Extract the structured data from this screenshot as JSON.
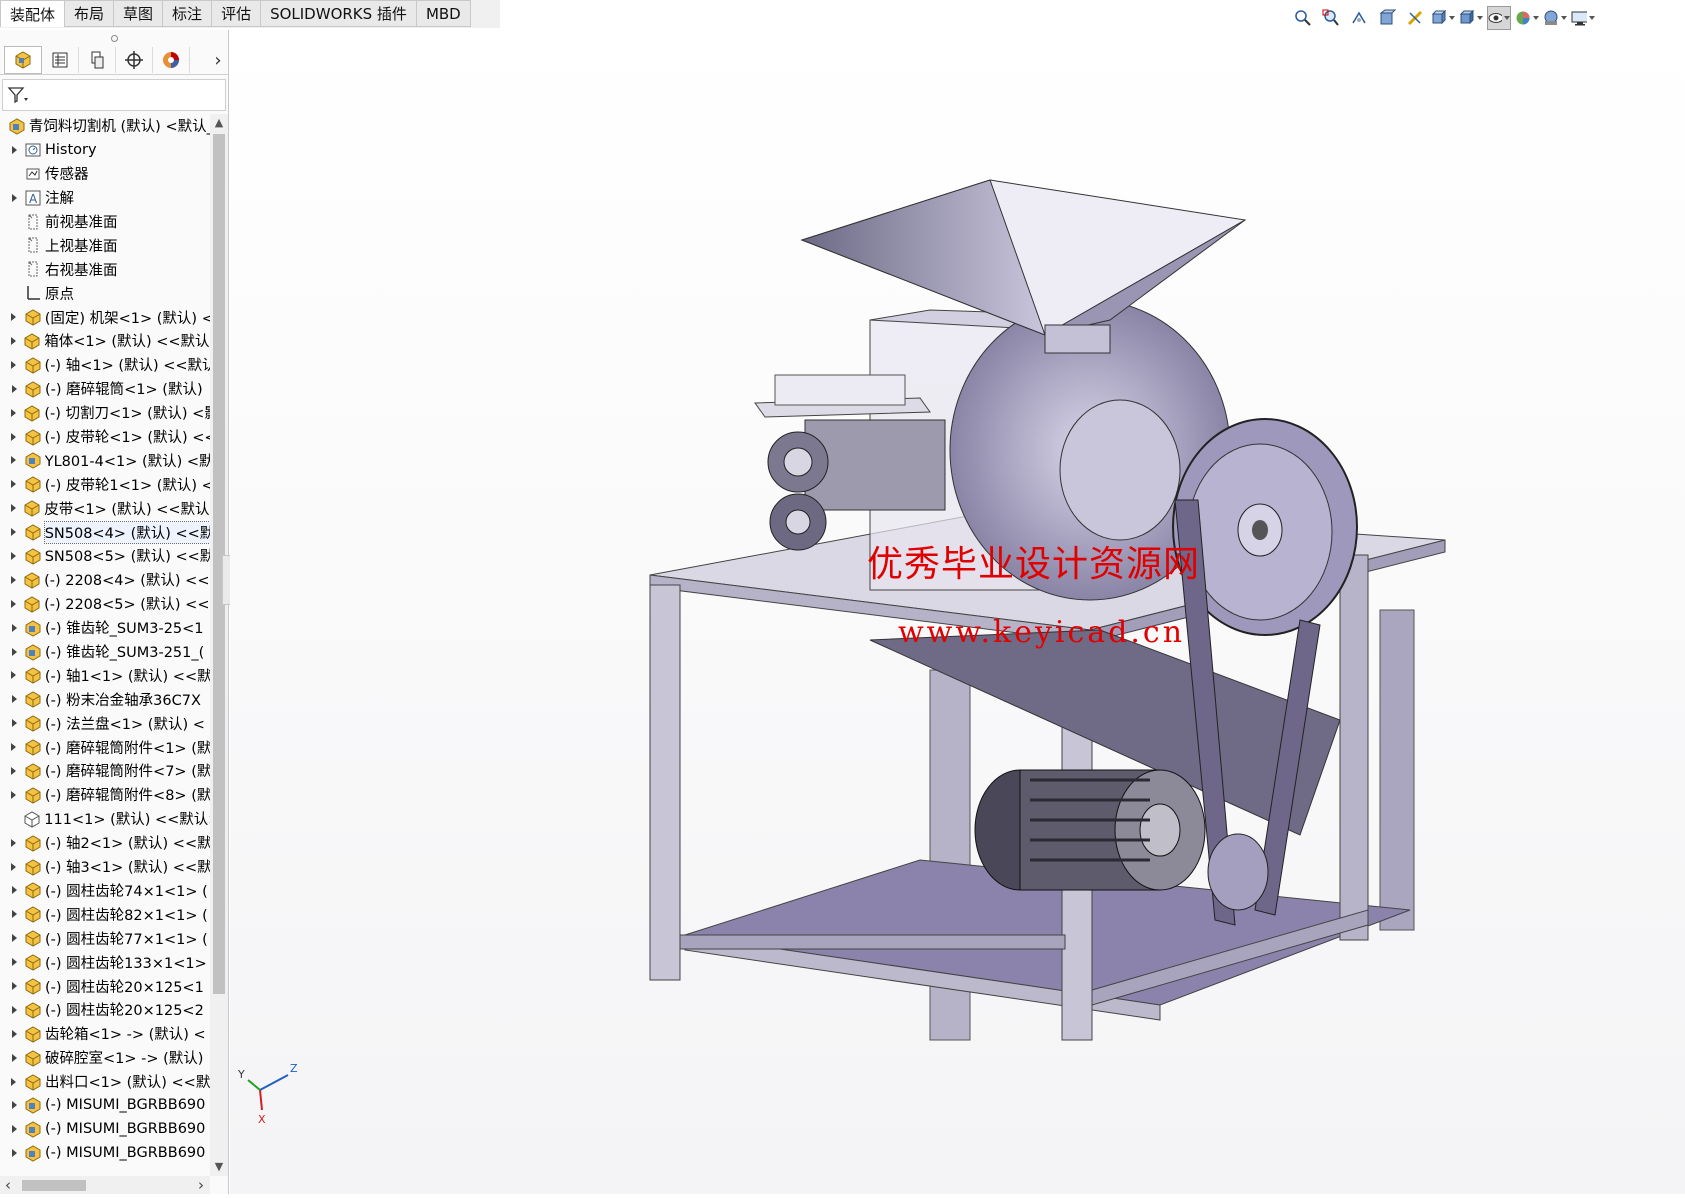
{
  "command_tabs": [
    "装配体",
    "布局",
    "草图",
    "标注",
    "评估",
    "SOLIDWORKS 插件",
    "MBD"
  ],
  "active_tab": "装配体",
  "tree": {
    "root_label": "青饲料切割机 (默认) <默认_",
    "items": [
      {
        "label": "History",
        "icon": "history-folder-icon",
        "expand": true
      },
      {
        "label": "传感器",
        "icon": "sensor-icon",
        "expand": false
      },
      {
        "label": "注解",
        "icon": "annotation-icon",
        "expand": true
      },
      {
        "label": "前视基准面",
        "icon": "plane-icon",
        "expand": false
      },
      {
        "label": "上视基准面",
        "icon": "plane-icon",
        "expand": false
      },
      {
        "label": "右视基准面",
        "icon": "plane-icon",
        "expand": false
      },
      {
        "label": "原点",
        "icon": "origin-icon",
        "expand": false
      },
      {
        "label": "(固定) 机架<1> (默认) <",
        "icon": "part-icon",
        "expand": true
      },
      {
        "label": "箱体<1> (默认) <<默认>",
        "icon": "part-icon",
        "expand": true
      },
      {
        "label": "(-) 轴<1> (默认) <<默认",
        "icon": "part-icon",
        "expand": true
      },
      {
        "label": "(-) 磨碎辊筒<1> (默认)",
        "icon": "part-icon",
        "expand": true
      },
      {
        "label": "(-) 切割刀<1> (默认) <影",
        "icon": "part-icon",
        "expand": true
      },
      {
        "label": "(-) 皮带轮<1> (默认) <<",
        "icon": "part-icon",
        "expand": true
      },
      {
        "label": "YL801-4<1> (默认) <默",
        "icon": "assembly-icon",
        "expand": true
      },
      {
        "label": "(-) 皮带轮1<1> (默认) <",
        "icon": "part-icon",
        "expand": true
      },
      {
        "label": "皮带<1> (默认) <<默认>",
        "icon": "part-icon",
        "expand": true
      },
      {
        "label": "SN508<4> (默认) <<默",
        "icon": "part-icon",
        "expand": true,
        "highlight": true
      },
      {
        "label": "SN508<5> (默认) <<默",
        "icon": "part-icon",
        "expand": true
      },
      {
        "label": "(-) 2208<4> (默认) <<默",
        "icon": "part-icon",
        "expand": true
      },
      {
        "label": "(-) 2208<5> (默认) <<默",
        "icon": "part-icon",
        "expand": true
      },
      {
        "label": "(-) 锥齿轮_SUM3-25<1",
        "icon": "assembly-icon",
        "expand": true
      },
      {
        "label": "(-) 锥齿轮_SUM3-251_(",
        "icon": "assembly-icon",
        "expand": true
      },
      {
        "label": "(-) 轴1<1> (默认) <<默",
        "icon": "part-icon",
        "expand": true
      },
      {
        "label": "(-) 粉末冶金轴承36C7X",
        "icon": "part-icon",
        "expand": true
      },
      {
        "label": "(-) 法兰盘<1> (默认) <",
        "icon": "part-icon",
        "expand": true
      },
      {
        "label": "(-) 磨碎辊筒附件<1> (默",
        "icon": "part-icon",
        "expand": true
      },
      {
        "label": "(-) 磨碎辊筒附件<7> (默",
        "icon": "part-icon",
        "expand": true
      },
      {
        "label": "(-) 磨碎辊筒附件<8> (默",
        "icon": "part-icon",
        "expand": true
      },
      {
        "label": "111<1> (默认) <<默认>",
        "icon": "part-hollow-icon",
        "expand": false
      },
      {
        "label": "(-) 轴2<1> (默认) <<默",
        "icon": "part-icon",
        "expand": true
      },
      {
        "label": "(-) 轴3<1> (默认) <<默",
        "icon": "part-icon",
        "expand": true
      },
      {
        "label": "(-) 圆柱齿轮74×1<1> (",
        "icon": "part-icon",
        "expand": true
      },
      {
        "label": "(-) 圆柱齿轮82×1<1> (",
        "icon": "part-icon",
        "expand": true
      },
      {
        "label": "(-) 圆柱齿轮77×1<1> (",
        "icon": "part-icon",
        "expand": true
      },
      {
        "label": "(-) 圆柱齿轮133×1<1>",
        "icon": "part-icon",
        "expand": true
      },
      {
        "label": "(-) 圆柱齿轮20×125<1",
        "icon": "part-icon",
        "expand": true
      },
      {
        "label": "(-) 圆柱齿轮20×125<2",
        "icon": "part-icon",
        "expand": true
      },
      {
        "label": "齿轮箱<1> -> (默认) <",
        "icon": "part-icon",
        "expand": true
      },
      {
        "label": "破碎腔室<1> -> (默认)",
        "icon": "part-icon",
        "expand": true
      },
      {
        "label": "出料口<1> (默认) <<默",
        "icon": "part-icon",
        "expand": true
      },
      {
        "label": "(-) MISUMI_BGRBB690",
        "icon": "assembly-icon",
        "expand": true
      },
      {
        "label": "(-) MISUMI_BGRBB690",
        "icon": "assembly-icon",
        "expand": true
      },
      {
        "label": "(-) MISUMI_BGRBB690",
        "icon": "assembly-icon",
        "expand": true
      }
    ]
  },
  "watermark": {
    "line1": "优秀毕业设计资源网",
    "line2": "www.keyicad.cn"
  },
  "triad": {
    "x": "X",
    "y": "Y",
    "z": "Z"
  },
  "hud_icons": [
    "zoom-to-fit-icon",
    "zoom-area-icon",
    "previous-view-icon",
    "section-view-icon",
    "dynamic-annotation-icon",
    "view-orientation-icon",
    "display-style-icon",
    "hide-show-icon",
    "edit-appearance-icon",
    "apply-scene-icon",
    "view-settings-icon"
  ],
  "colors": {
    "accent": "#7b6fa1",
    "watermark": "#e00000",
    "frame": "#a7a2b8"
  }
}
